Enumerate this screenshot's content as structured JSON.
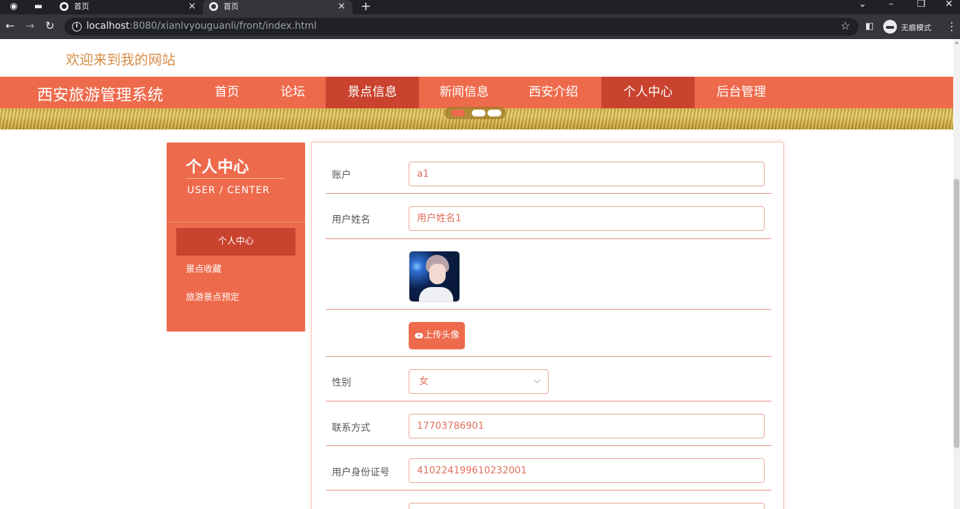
{
  "browser": {
    "tabs": [
      {
        "title": "首页"
      },
      {
        "title": "首页"
      }
    ],
    "url_host": "localhost",
    "url_rest": ":8080/xianlvyouguanli/front/index.html",
    "incognito_label": "无痕模式"
  },
  "site": {
    "welcome": "欢迎来到我的网站",
    "brand": "西安旅游管理系统",
    "nav": [
      {
        "label": "首页"
      },
      {
        "label": "论坛"
      },
      {
        "label": "景点信息"
      },
      {
        "label": "新闻信息"
      },
      {
        "label": "西安介绍"
      },
      {
        "label": "个人中心"
      },
      {
        "label": "后台管理"
      }
    ]
  },
  "sidebar": {
    "title": "个人中心",
    "subtitle": "USER / CENTER",
    "items": [
      {
        "label": "个人中心"
      },
      {
        "label": "景点收藏"
      },
      {
        "label": "旅游景点预定"
      }
    ]
  },
  "form": {
    "account_label": "账户",
    "account_value": "a1",
    "name_label": "用户姓名",
    "name_value": "用户姓名1",
    "upload_label": "上传头像",
    "gender_label": "性别",
    "gender_value": "女",
    "phone_label": "联系方式",
    "phone_value": "17703786901",
    "idcard_label": "用户身份证号",
    "idcard_value": "410224199610232001"
  },
  "colors": {
    "accent": "#ee6a4c",
    "accent_dark": "#c9432f",
    "welcome_text": "#d98c47"
  }
}
